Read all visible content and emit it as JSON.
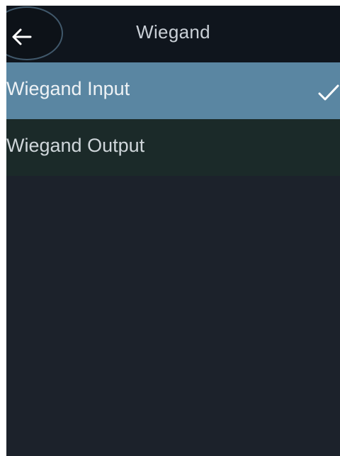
{
  "header": {
    "title": "Wiegand",
    "back_icon": "arrow-left-icon"
  },
  "menu": {
    "items": [
      {
        "label": "Wiegand Input",
        "selected": true,
        "icon": "check-icon"
      },
      {
        "label": "Wiegand Output",
        "selected": false
      }
    ]
  },
  "colors": {
    "background": "#1c222b",
    "header": "#0f151d",
    "selected_row": "#5a86a2",
    "unselected_row": "#1b2a29"
  }
}
